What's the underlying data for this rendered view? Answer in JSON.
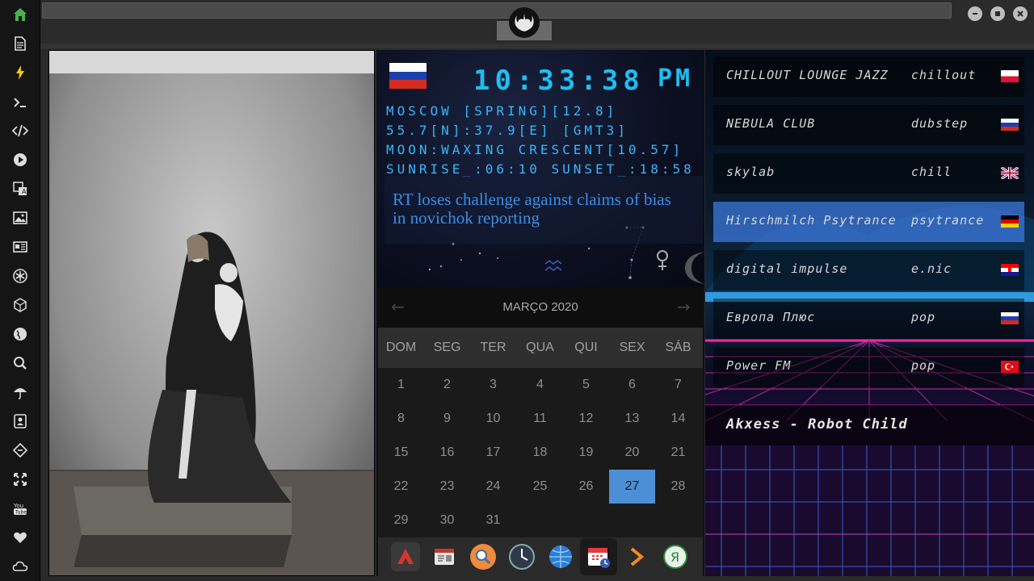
{
  "clock": {
    "time": "10:33:38",
    "ampm": "PM"
  },
  "location": {
    "line1": "MOSCOW [SPRING][12.8]",
    "line2": "55.7[N]:37.9[E] [GMT3]",
    "line3": "MOON:WAXING CRESCENT[10.57]",
    "line4": "SUNRISE_:06:10 SUNSET_:18:58"
  },
  "news": {
    "headline": "RT loses challenge against claims of bias in novichok reporting"
  },
  "calendar": {
    "title": "MARÇO 2020",
    "weekdays": [
      "DOM",
      "SEG",
      "TER",
      "QUA",
      "QUI",
      "SEX",
      "SÁB"
    ],
    "today": 27
  },
  "stations": [
    {
      "name": "CHILLOUT LOUNGE JAZZ",
      "genre": "chillout",
      "flag": "PL"
    },
    {
      "name": "NEBULA CLUB",
      "genre": "dubstep",
      "flag": "RU"
    },
    {
      "name": "skylab",
      "genre": "chill",
      "flag": "GB"
    },
    {
      "name": "Hirschmilch Psytrance",
      "genre": "psytrance",
      "flag": "DE"
    },
    {
      "name": "digital impulse",
      "genre": "e.nic",
      "flag": "HR"
    },
    {
      "name": "Европа Плюс",
      "genre": "pop",
      "flag": "RU"
    },
    {
      "name": "Power FM",
      "genre": "pop",
      "flag": "TR"
    }
  ],
  "now_playing": {
    "title": "Akxess - Robot Child"
  },
  "sidebar_icons": [
    "home-icon",
    "document-icon",
    "flash-icon",
    "terminal-icon",
    "code-icon",
    "play-icon",
    "translate-icon",
    "image-icon",
    "news-icon",
    "settings-icon",
    "cube-icon",
    "globe-icon",
    "search-icon",
    "umbrella-icon",
    "contacts-icon",
    "tag-icon",
    "expand-icon",
    "youtube-icon",
    "heart-icon",
    "cloud-icon"
  ],
  "dock_icons": [
    "vector-app-icon",
    "calendar-news-icon",
    "search-app-icon",
    "clock-app-icon",
    "browser-icon",
    "calendar-app-icon",
    "arrow-app-icon",
    "yandex-icon"
  ],
  "colors": {
    "accent_blue": "#1fbdf0",
    "calendar_today": "#4d8fd6",
    "station_active": "#3c78dc"
  }
}
